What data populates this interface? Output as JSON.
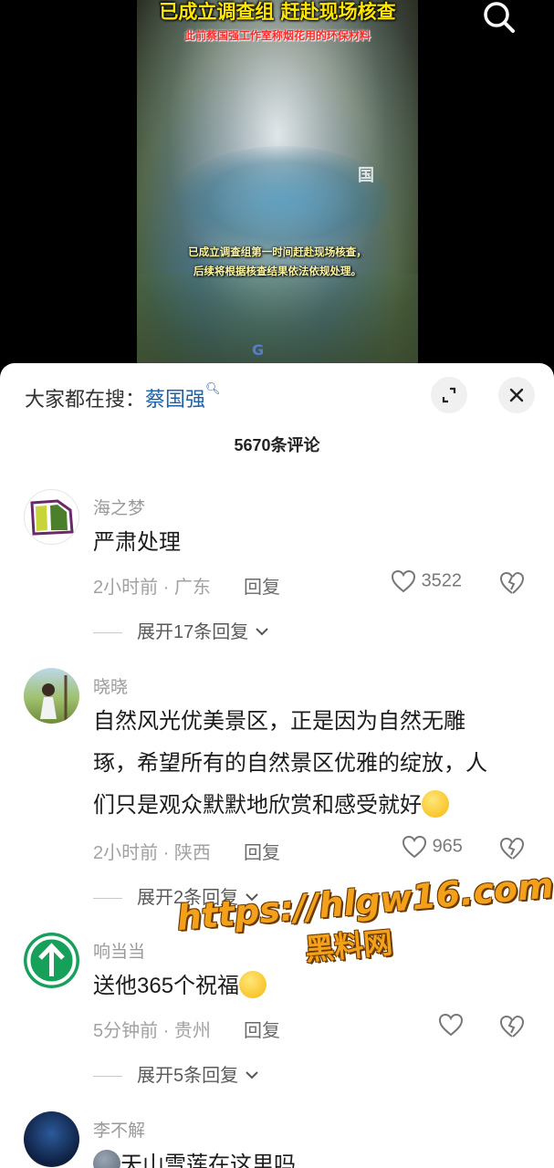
{
  "video": {
    "title": "已成立调查组 赶赴现场核查",
    "subtitle": "此前蔡国强工作室称烟花用的环保材料",
    "caption_line1": "已成立调查组第一时间赶赴现场核查，",
    "caption_line2": "后续将根据核查结果依法依规处理。",
    "logo_text": "国",
    "bottom_logo_text": "G"
  },
  "header": {
    "hot_search_label": "大家都在搜：",
    "hot_search_term": "蔡国强",
    "comment_count": "5670条评论"
  },
  "comments": [
    {
      "user": "海之梦",
      "text": "严肃处理",
      "meta": "2小时前 · 广东",
      "reply": "回复",
      "likes": "3522",
      "expand": "展开17条回复"
    },
    {
      "user": "晓晓",
      "text_line1": "自然风光优美景区，正是因为自然无雕",
      "text_line2": "琢，希望所有的自然景区优雅的绽放，人",
      "text_line3": "们只是观众默默地欣赏和感受就好",
      "meta": "2小时前 · 陕西",
      "reply": "回复",
      "likes": "965",
      "expand": "展开2条回复"
    },
    {
      "user": "响当当",
      "text": "送他365个祝福",
      "meta": "5分钟前 · 贵州",
      "reply": "回复",
      "likes": "",
      "expand": "展开5条回复"
    },
    {
      "user": "李不解",
      "text": "天山雪莲在这里吗"
    }
  ],
  "watermark": {
    "url": "https://hlgw16.com",
    "name": "黑料网"
  },
  "colors": {
    "accent_link": "#1f5fa6",
    "title_yellow": "#ffe600",
    "subtitle_red": "#ff2a2a",
    "watermark_orange": "#f3a11b"
  }
}
